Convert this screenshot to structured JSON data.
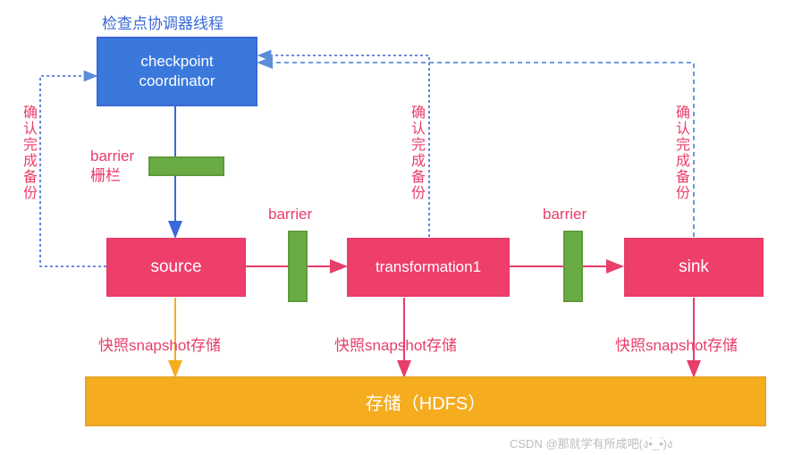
{
  "title": "检查点协调器线程",
  "coordinator": {
    "line1": "checkpoint",
    "line2": "coordinator"
  },
  "barrierLabel": "barrier\n栅栏",
  "barrier2": "barrier",
  "barrier3": "barrier",
  "ack1": "确认完成备份",
  "ack2": "确认完成备份",
  "ack3": "确认完成备份",
  "source": "source",
  "transformation": "transformation1",
  "sink": "sink",
  "snapshot1": "快照snapshot存储",
  "snapshot2": "快照snapshot存储",
  "snapshot3": "快照snapshot存储",
  "storage": "存储（HDFS）",
  "watermark": "CSDN @那就学有所成吧(ง•̀_•́)ง"
}
